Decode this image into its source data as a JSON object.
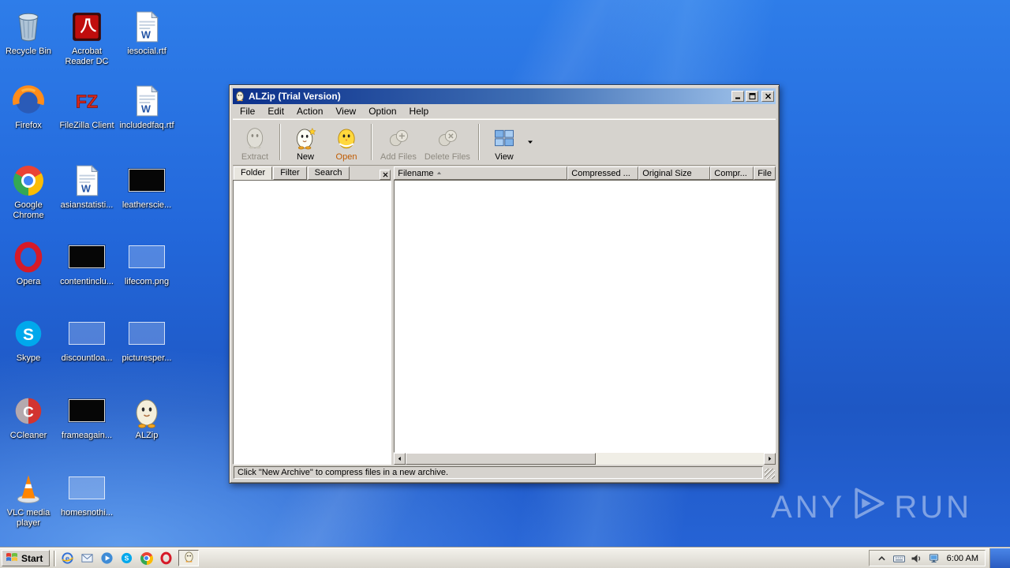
{
  "desktop": {
    "icons": [
      {
        "id": "recycle-bin",
        "label": "Recycle Bin",
        "kind": "recycle-bin",
        "col": 0,
        "row": 0
      },
      {
        "id": "acrobat-reader",
        "label": "Acrobat Reader DC",
        "kind": "acrobat",
        "col": 1,
        "row": 0
      },
      {
        "id": "iesocial-rtf",
        "label": "iesocial.rtf",
        "kind": "word-doc",
        "col": 2,
        "row": 0
      },
      {
        "id": "firefox",
        "label": "Firefox",
        "kind": "firefox",
        "col": 0,
        "row": 1
      },
      {
        "id": "filezilla",
        "label": "FileZilla Client",
        "kind": "filezilla",
        "col": 1,
        "row": 1
      },
      {
        "id": "includedfaq-rtf",
        "label": "includedfaq.rtf",
        "kind": "word-doc",
        "col": 2,
        "row": 1
      },
      {
        "id": "google-chrome",
        "label": "Google Chrome",
        "kind": "chrome",
        "col": 0,
        "row": 2
      },
      {
        "id": "asianstatisti",
        "label": "asianstatisti...",
        "kind": "word-doc",
        "col": 1,
        "row": 2
      },
      {
        "id": "leatherscie",
        "label": "leatherscie...",
        "kind": "img-black",
        "col": 2,
        "row": 2
      },
      {
        "id": "opera",
        "label": "Opera",
        "kind": "opera",
        "col": 0,
        "row": 3
      },
      {
        "id": "contentinclu",
        "label": "contentinclu...",
        "kind": "img-black",
        "col": 1,
        "row": 3
      },
      {
        "id": "lifecom-png",
        "label": "lifecom.png",
        "kind": "img-faint",
        "col": 2,
        "row": 3
      },
      {
        "id": "skype",
        "label": "Skype",
        "kind": "skype",
        "col": 0,
        "row": 4
      },
      {
        "id": "discountloa",
        "label": "discountloa...",
        "kind": "img-faint",
        "col": 1,
        "row": 4
      },
      {
        "id": "picturesper",
        "label": "picturesper...",
        "kind": "img-faint",
        "col": 2,
        "row": 4
      },
      {
        "id": "ccleaner",
        "label": "CCleaner",
        "kind": "ccleaner",
        "col": 0,
        "row": 5
      },
      {
        "id": "frameagain",
        "label": "frameagain...",
        "kind": "img-black",
        "col": 1,
        "row": 5
      },
      {
        "id": "alzip",
        "label": "ALZip",
        "kind": "alzip-egg",
        "col": 2,
        "row": 5
      },
      {
        "id": "vlc",
        "label": "VLC media player",
        "kind": "vlc",
        "col": 0,
        "row": 6
      },
      {
        "id": "homesnothi",
        "label": "homesnothi...",
        "kind": "img-faint",
        "col": 1,
        "row": 6
      }
    ]
  },
  "window": {
    "title": "ALZip (Trial Version)",
    "menu": [
      "File",
      "Edit",
      "Action",
      "View",
      "Option",
      "Help"
    ],
    "toolbar": [
      {
        "id": "extract",
        "label": "Extract",
        "kind": "extract",
        "enabled": false
      },
      {
        "sep": true
      },
      {
        "id": "new",
        "label": "New",
        "kind": "new",
        "enabled": true
      },
      {
        "id": "open",
        "label": "Open",
        "kind": "open",
        "enabled": true,
        "label_color": "#c05a00"
      },
      {
        "sep": true
      },
      {
        "id": "add-files",
        "label": "Add Files",
        "kind": "add-files",
        "enabled": false
      },
      {
        "id": "delete-files",
        "label": "Delete Files",
        "kind": "delete-files",
        "enabled": false
      },
      {
        "sep": true
      },
      {
        "id": "view",
        "label": "View",
        "kind": "view-grid",
        "enabled": true,
        "dropdown": true
      }
    ],
    "left_tabs": [
      {
        "label": "Folder",
        "active": true
      },
      {
        "label": "Filter",
        "active": false
      },
      {
        "label": "Search",
        "active": false
      }
    ],
    "columns": [
      {
        "id": "filename",
        "label": "Filename",
        "sort": "asc"
      },
      {
        "id": "compressed-size",
        "label": "Compressed ..."
      },
      {
        "id": "original-size",
        "label": "Original Size"
      },
      {
        "id": "compression-ratio",
        "label": "Compr..."
      },
      {
        "id": "file-type",
        "label": "File"
      }
    ],
    "status": "Click \"New Archive\" to compress files in a new archive."
  },
  "taskbar": {
    "start_label": "Start",
    "quick_launch": [
      "internet-explorer",
      "mail",
      "media-player",
      "skype",
      "chrome",
      "opera"
    ],
    "running_app": "alzip",
    "tray_icons": [
      "hidden-icons",
      "keyboard",
      "volume",
      "network"
    ],
    "clock": "6:00 AM"
  },
  "watermark": {
    "left": "ANY",
    "right": "RUN"
  }
}
